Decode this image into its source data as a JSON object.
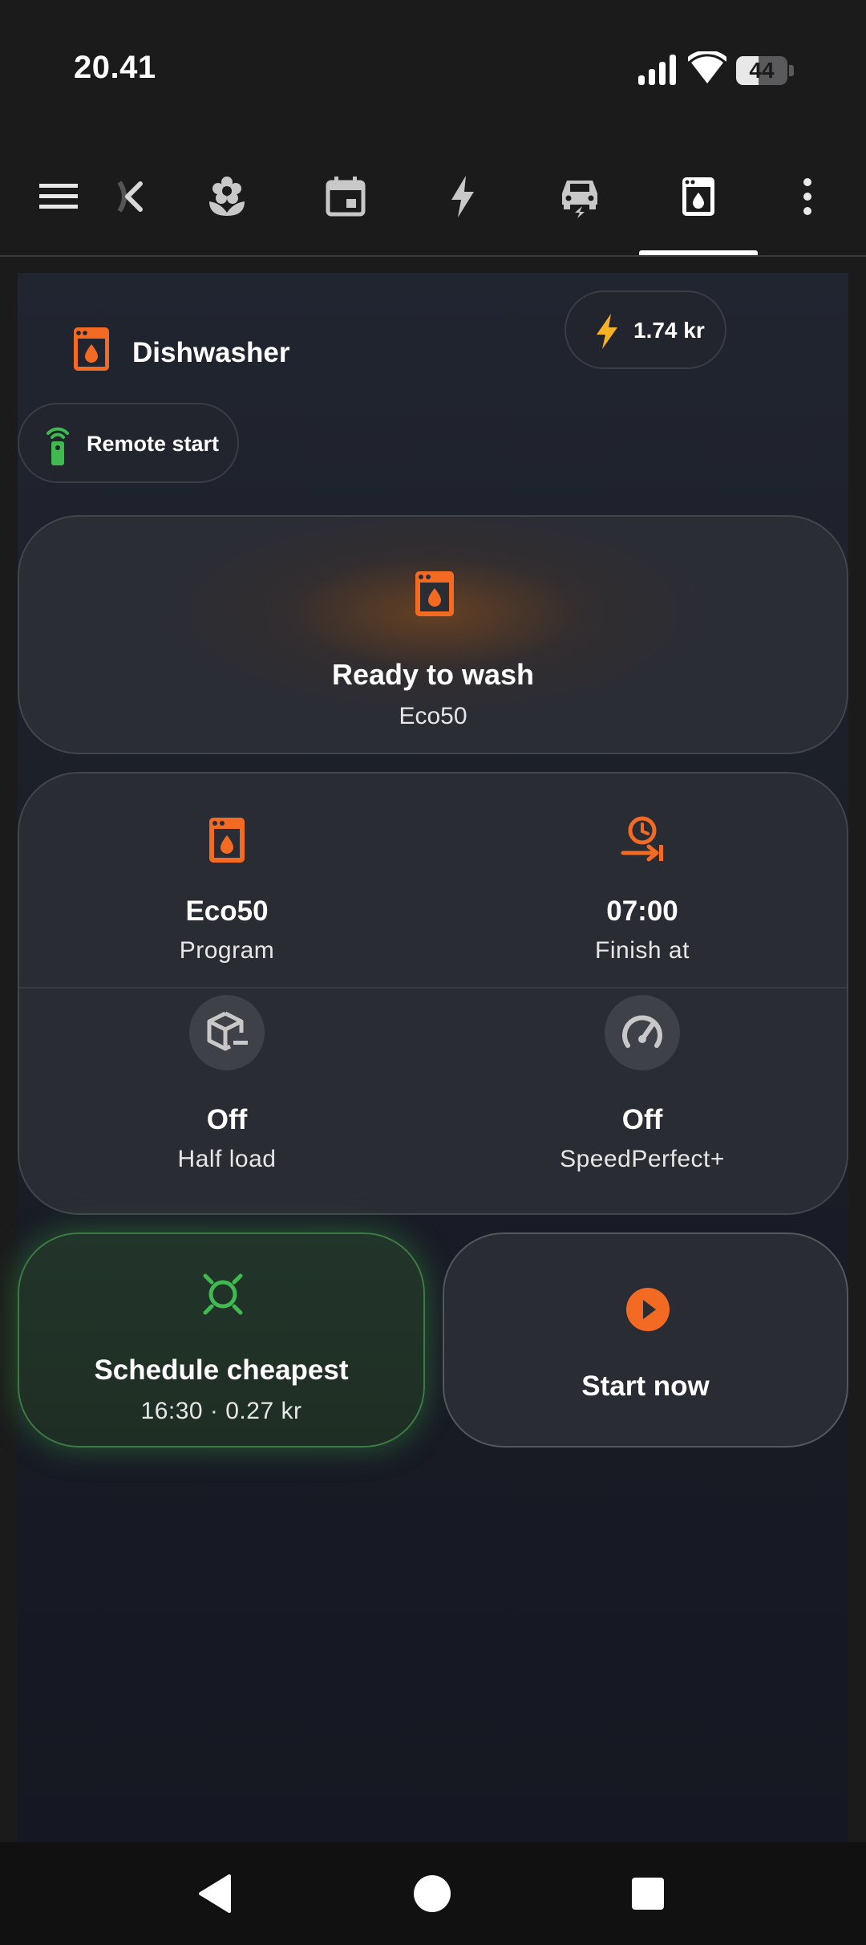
{
  "status_bar": {
    "time": "20.41",
    "battery_level": "44",
    "battery_fraction": 0.44
  },
  "app_bar": {
    "tabs": [
      {
        "icon": "menu-icon"
      },
      {
        "icon": "back-chevron-icon"
      },
      {
        "icon": "flower-icon"
      },
      {
        "icon": "calendar-icon"
      },
      {
        "icon": "lightning-icon"
      },
      {
        "icon": "car-charging-icon"
      },
      {
        "icon": "dishwasher-icon",
        "selected": true
      },
      {
        "icon": "more-vert-icon"
      }
    ]
  },
  "device": {
    "title": "Dishwasher",
    "price": "1.74 kr",
    "remote_start": "Remote start"
  },
  "status": {
    "title": "Ready to wash",
    "program": "Eco50"
  },
  "settings": {
    "program_value": "Eco50",
    "program_label": "Program",
    "finish_value": "07:00",
    "finish_label": "Finish at",
    "half_load_value": "Off",
    "half_load_label": "Half load",
    "speed_value": "Off",
    "speed_label": "SpeedPerfect+"
  },
  "actions": {
    "schedule_title": "Schedule cheapest",
    "schedule_detail": "16:30 · 0.27 kr",
    "start_title": "Start now"
  },
  "colors": {
    "accent_orange": "#f36b23",
    "accent_green": "#3fb950",
    "price_yellow": "#f5b324"
  }
}
